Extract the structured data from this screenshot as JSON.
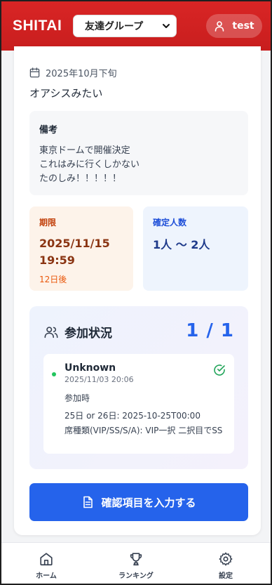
{
  "header": {
    "logo": "SHITAI",
    "group_select": "友達グループ",
    "user_name": "test"
  },
  "event": {
    "date_text": "2025年10月下旬",
    "title": "オアシスみたい",
    "notes_label": "備考",
    "notes_lines": [
      "東京ドームで開催決定",
      "これはみに行くしかない",
      "たのしみ！！！！！"
    ]
  },
  "deadline": {
    "label": "期限",
    "date": "2025/11/15",
    "time": "19:59",
    "relative": "12日後"
  },
  "confirmed": {
    "label": "確定人数",
    "value": "1人 〜 2人"
  },
  "participation": {
    "title": "参加状況",
    "count": "1 / 1",
    "members": [
      {
        "name": "Unknown",
        "timestamp": "2025/11/03 20:06",
        "section_label": "参加時",
        "answer1": "25日 or 26日: 2025-10-25T00:00",
        "answer2": "席種類(VIP/SS/S/A): VIP一択 二択目でSS",
        "status_color": "#22c55e"
      }
    ]
  },
  "actions": {
    "confirm_label": "確認項目を入力する"
  },
  "bottom_nav": [
    {
      "label": "ホーム",
      "icon": "home-icon"
    },
    {
      "label": "ランキング",
      "icon": "trophy-icon"
    },
    {
      "label": "設定",
      "icon": "gear-icon"
    }
  ],
  "colors": {
    "brand": "#d92525",
    "primary": "#2563eb",
    "deadline_text": "#8a3412",
    "confirmed_text": "#1e3a8a"
  }
}
